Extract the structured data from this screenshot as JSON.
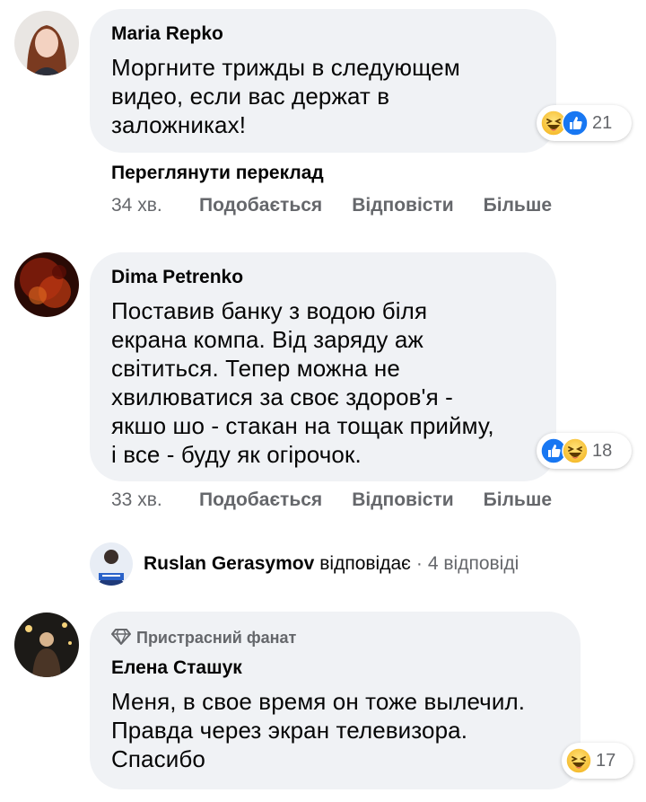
{
  "comments": [
    {
      "author": "Maria Repko",
      "text": "Моргните трижды в следующем\nвидео, если вас держат в\nзаложниках!",
      "reaction_count": "21",
      "reactions": [
        "haha",
        "like"
      ],
      "translate_label": "Переглянути переклад",
      "time": "34 хв.",
      "like_label": "Подобається",
      "reply_label": "Відповісти",
      "more_label": "Більше"
    },
    {
      "author": "Dima Petrenko",
      "text": "Поставив банку з водою біля\nекрана компа. Від заряду аж\nсвітиться. Тепер можна не\nхвилюватися за своє здоров'я -\nякшо шо - стакан на тощак прийму,\nі все - буду як огірочок.",
      "reaction_count": "18",
      "reactions": [
        "like",
        "haha"
      ],
      "time": "33 хв.",
      "like_label": "Подобається",
      "reply_label": "Відповісти",
      "more_label": "Більше",
      "reply_summary": {
        "name": "Ruslan Gerasymov",
        "verb": "відповідає",
        "separator": "·",
        "count": "4 відповіді"
      }
    },
    {
      "badge": "Пристрасний фанат",
      "author": "Елена Сташук",
      "text": "Меня, в свое время он тоже вылечил.\nПравда через экран телевизора.\nСпасибо",
      "reaction_count": "17",
      "reactions": [
        "haha"
      ]
    }
  ],
  "colors": {
    "bubble": "#f0f2f5",
    "secondary_text": "#65676b",
    "like_blue": "#1877f2",
    "haha_yellow": "#f7c948"
  },
  "icons": [
    "like-icon",
    "haha-icon",
    "gem-icon"
  ]
}
